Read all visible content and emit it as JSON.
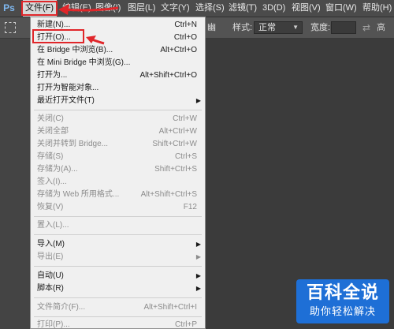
{
  "app": {
    "logo": "Ps"
  },
  "menubar": {
    "items": [
      {
        "label": "文件(F)"
      },
      {
        "label": "编辑(E)"
      },
      {
        "label": "图像(I)"
      },
      {
        "label": "图层(L)"
      },
      {
        "label": "文字(Y)"
      },
      {
        "label": "选择(S)"
      },
      {
        "label": "滤镜(T)"
      },
      {
        "label": "3D(D)"
      },
      {
        "label": "视图(V)"
      },
      {
        "label": "窗口(W)"
      },
      {
        "label": "帮助(H)"
      }
    ]
  },
  "options_bar": {
    "partial_label": "幽",
    "style_label": "样式:",
    "style_value": "正常",
    "width_label": "宽度:",
    "height_label": "高"
  },
  "file_menu": {
    "items": [
      {
        "label": "新建(N)...",
        "shortcut": "Ctrl+N"
      },
      {
        "label": "打开(O)...",
        "shortcut": "Ctrl+O"
      },
      {
        "label": "在 Bridge 中浏览(B)...",
        "shortcut": "Alt+Ctrl+O"
      },
      {
        "label": "在 Mini Bridge 中浏览(G)...",
        "shortcut": ""
      },
      {
        "label": "打开为...",
        "shortcut": "Alt+Shift+Ctrl+O"
      },
      {
        "label": "打开为智能对象...",
        "shortcut": ""
      },
      {
        "label": "最近打开文件(T)",
        "shortcut": ""
      },
      {
        "label": "关闭(C)",
        "shortcut": "Ctrl+W"
      },
      {
        "label": "关闭全部",
        "shortcut": "Alt+Ctrl+W"
      },
      {
        "label": "关闭并转到 Bridge...",
        "shortcut": "Shift+Ctrl+W"
      },
      {
        "label": "存储(S)",
        "shortcut": "Ctrl+S"
      },
      {
        "label": "存储为(A)...",
        "shortcut": "Shift+Ctrl+S"
      },
      {
        "label": "签入(I)...",
        "shortcut": ""
      },
      {
        "label": "存储为 Web 所用格式...",
        "shortcut": "Alt+Shift+Ctrl+S"
      },
      {
        "label": "恢复(V)",
        "shortcut": "F12"
      },
      {
        "label": "置入(L)...",
        "shortcut": ""
      },
      {
        "label": "导入(M)",
        "shortcut": ""
      },
      {
        "label": "导出(E)",
        "shortcut": ""
      },
      {
        "label": "自动(U)",
        "shortcut": ""
      },
      {
        "label": "脚本(R)",
        "shortcut": ""
      },
      {
        "label": "文件简介(F)...",
        "shortcut": "Alt+Shift+Ctrl+I"
      },
      {
        "label": "打印(P)...",
        "shortcut": "Ctrl+P"
      }
    ]
  },
  "watermark": {
    "title": "百科全说",
    "subtitle": "助你轻松解决"
  },
  "colors": {
    "highlight": "#e0262a",
    "menu_bg": "#f0f0f0",
    "app_bg": "#535353",
    "watermark_bg": "#1e6fd6"
  }
}
